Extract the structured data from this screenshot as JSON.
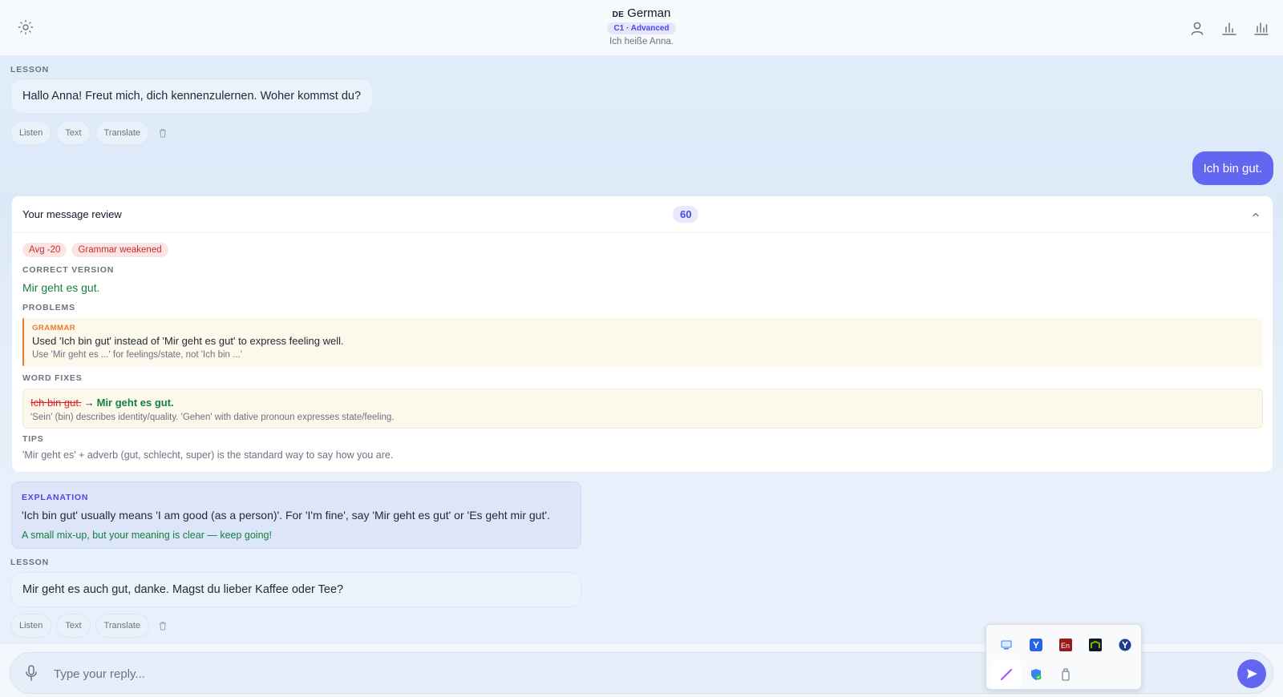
{
  "header": {
    "lang_code": "DE",
    "lang_name": "German",
    "level": "C1 · Advanced",
    "subtitle": "Ich heiße Anna."
  },
  "lesson_label": "LESSON",
  "message1": "Hallo Anna! Freut mich, dich kennenzulernen. Woher kommst du?",
  "actions": {
    "listen": "Listen",
    "text": "Text",
    "translate": "Translate"
  },
  "user_message": "Ich bin gut.",
  "review": {
    "title": "Your message review",
    "score": "60",
    "tags": [
      "Avg -20",
      "Grammar weakened"
    ],
    "correct_label": "CORRECT VERSION",
    "correct_text": "Mir geht es gut.",
    "problems_label": "PROBLEMS",
    "problem": {
      "type": "GRAMMAR",
      "text": "Used 'Ich bin gut' instead of 'Mir geht es gut' to express feeling well.",
      "hint": "Use 'Mir geht es ...' for feelings/state, not 'Ich bin ...'"
    },
    "word_fixes_label": "WORD FIXES",
    "fix": {
      "old": "Ich bin gut.",
      "arrow": "→",
      "new": "Mir geht es gut.",
      "note": "'Sein' (bin) describes identity/quality. 'Gehen' with dative pronoun expresses state/feeling."
    },
    "tips_label": "TIPS",
    "tip": "'Mir geht es' + adverb (gut, schlecht, super) is the standard way to say how you are."
  },
  "explanation": {
    "label": "EXPLANATION",
    "text": "'Ich bin gut' usually means 'I am good (as a person)'. For 'I'm fine', say 'Mir geht es gut' or 'Es geht mir gut'.",
    "encouragement": "A small mix-up, but your meaning is clear — keep going!"
  },
  "message2": "Mir geht es auch gut, danke. Magst du lieber Kaffee oder Tee?",
  "input": {
    "placeholder": "Type your reply..."
  },
  "tray_icons": [
    "remote-desktop-icon",
    "yandex-icon",
    "en-dictionary-icon",
    "nvidia-icon",
    "yandex-browser-icon",
    "pen-icon",
    "security-shield-icon",
    "usb-drive-icon"
  ],
  "colors": {
    "accent": "#6366f1",
    "success": "#15803d",
    "error": "#dc2626",
    "warning": "#ea7b2c"
  }
}
